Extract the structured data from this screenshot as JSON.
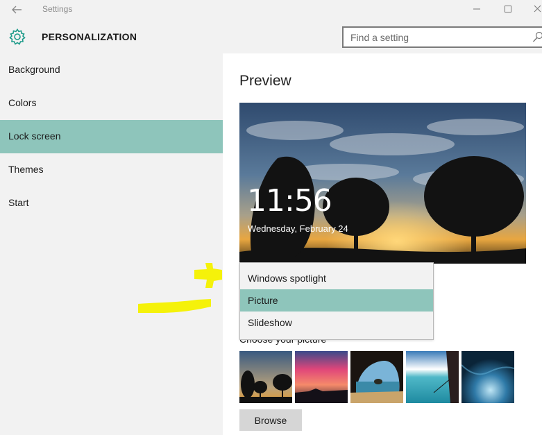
{
  "window": {
    "title": "Settings",
    "back_icon": "back-arrow-icon",
    "controls": [
      "minimize-icon",
      "maximize-icon",
      "close-icon"
    ]
  },
  "header": {
    "section_title": "PERSONALIZATION",
    "icon": "gear-icon",
    "search_placeholder": "Find a setting"
  },
  "sidebar": {
    "items": [
      {
        "label": "Background",
        "selected": false
      },
      {
        "label": "Colors",
        "selected": false
      },
      {
        "label": "Lock screen",
        "selected": true
      },
      {
        "label": "Themes",
        "selected": false
      },
      {
        "label": "Start",
        "selected": false
      }
    ]
  },
  "main": {
    "preview_title": "Preview",
    "lock_time": "11:56",
    "lock_date": "Wednesday, February 24",
    "dropdown": {
      "options": [
        "Windows spotlight",
        "Picture",
        "Slideshow"
      ],
      "selected": "Picture"
    },
    "choose_label": "Choose your picture",
    "browse_label": "Browse"
  },
  "colors": {
    "accent": "#8ec5bb",
    "sidebar_bg": "#f2f2f2",
    "annotation": "#f5f20a"
  }
}
